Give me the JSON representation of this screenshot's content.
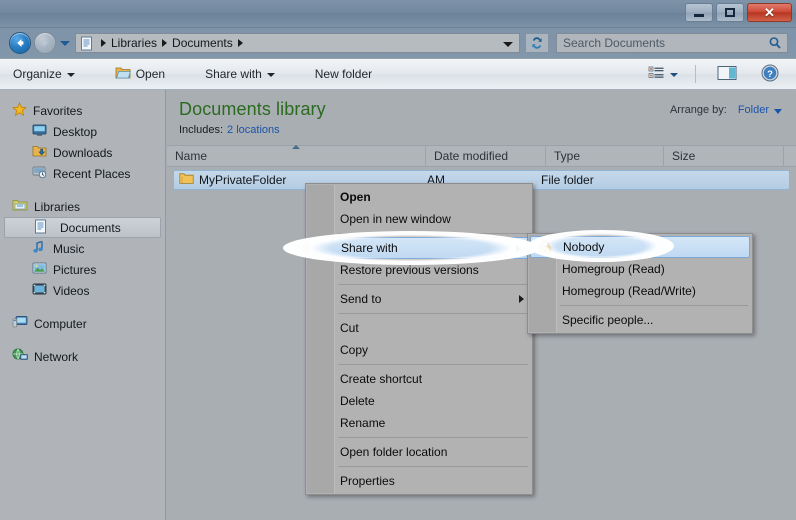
{
  "window": {
    "title": "",
    "controls": {
      "minimize": "Minimize",
      "maximize": "Maximize",
      "close": "Close",
      "close_glyph": "✕"
    }
  },
  "addressbar": {
    "back_tooltip": "Back",
    "forward_tooltip": "Forward",
    "history_tooltip": "Recent pages",
    "crumbs": [
      "Libraries",
      "Documents"
    ],
    "refresh_tooltip": "Refresh",
    "search_placeholder": "Search Documents"
  },
  "commandbar": {
    "organize": "Organize",
    "open": "Open",
    "share_with": "Share with",
    "new_folder": "New folder",
    "views_tooltip": "Change your view",
    "preview_tooltip": "Show the preview pane",
    "help_tooltip": "Get help"
  },
  "navpane": {
    "groups": [
      {
        "header": "Favorites",
        "icon": "star-icon",
        "items": [
          {
            "label": "Desktop",
            "icon": "desktop-icon"
          },
          {
            "label": "Downloads",
            "icon": "downloads-icon"
          },
          {
            "label": "Recent Places",
            "icon": "recent-places-icon"
          }
        ]
      },
      {
        "header": "Libraries",
        "icon": "library-folder-icon",
        "items": [
          {
            "label": "Documents",
            "icon": "document-icon",
            "selected": true
          },
          {
            "label": "Music",
            "icon": "music-icon"
          },
          {
            "label": "Pictures",
            "icon": "pictures-icon"
          },
          {
            "label": "Videos",
            "icon": "videos-icon"
          }
        ]
      },
      {
        "header": "Computer",
        "icon": "computer-icon",
        "items": []
      },
      {
        "header": "Network",
        "icon": "network-icon",
        "items": []
      }
    ]
  },
  "library": {
    "title": "Documents library",
    "includes_label": "Includes:",
    "includes_value": "2 locations",
    "arrange_label": "Arrange by:",
    "arrange_value": "Folder"
  },
  "filelist": {
    "columns": [
      {
        "label": "Name",
        "sorted": true
      },
      {
        "label": "Date modified"
      },
      {
        "label": "Type"
      },
      {
        "label": "Size"
      }
    ],
    "rows": [
      {
        "name": "MyPrivateFolder",
        "date_modified": "AM",
        "type": "File folder",
        "size": "",
        "icon": "folder-icon",
        "selected": true
      }
    ]
  },
  "context_menu": {
    "items": [
      {
        "label": "Open",
        "bold": true
      },
      {
        "label": "Open in new window"
      },
      {
        "separator": true
      },
      {
        "label": "Share with",
        "submenu": true,
        "highlighted": true
      },
      {
        "label": "Restore previous versions"
      },
      {
        "separator": true
      },
      {
        "label": "Send to",
        "submenu": true
      },
      {
        "separator": true
      },
      {
        "label": "Cut"
      },
      {
        "label": "Copy"
      },
      {
        "separator": true
      },
      {
        "label": "Create shortcut"
      },
      {
        "label": "Delete"
      },
      {
        "label": "Rename"
      },
      {
        "separator": true
      },
      {
        "label": "Open folder location"
      },
      {
        "separator": true
      },
      {
        "label": "Properties"
      }
    ]
  },
  "share_submenu": {
    "items": [
      {
        "label": "Nobody",
        "icon": "lock-icon",
        "highlighted": true
      },
      {
        "label": "Homegroup (Read)"
      },
      {
        "label": "Homegroup (Read/Write)"
      },
      {
        "separator": true
      },
      {
        "label": "Specific people..."
      }
    ]
  },
  "annotations": [
    {
      "name": "ellipse-share-with",
      "shape": "ellipse",
      "color": "#ffffff"
    },
    {
      "name": "ellipse-nobody",
      "shape": "ellipse",
      "color": "#ffffff"
    }
  ],
  "colors": {
    "library_title": "#2a6b1f",
    "link": "#1a54a8",
    "selection": "#bfd9f2",
    "close_button": "#c04328"
  }
}
